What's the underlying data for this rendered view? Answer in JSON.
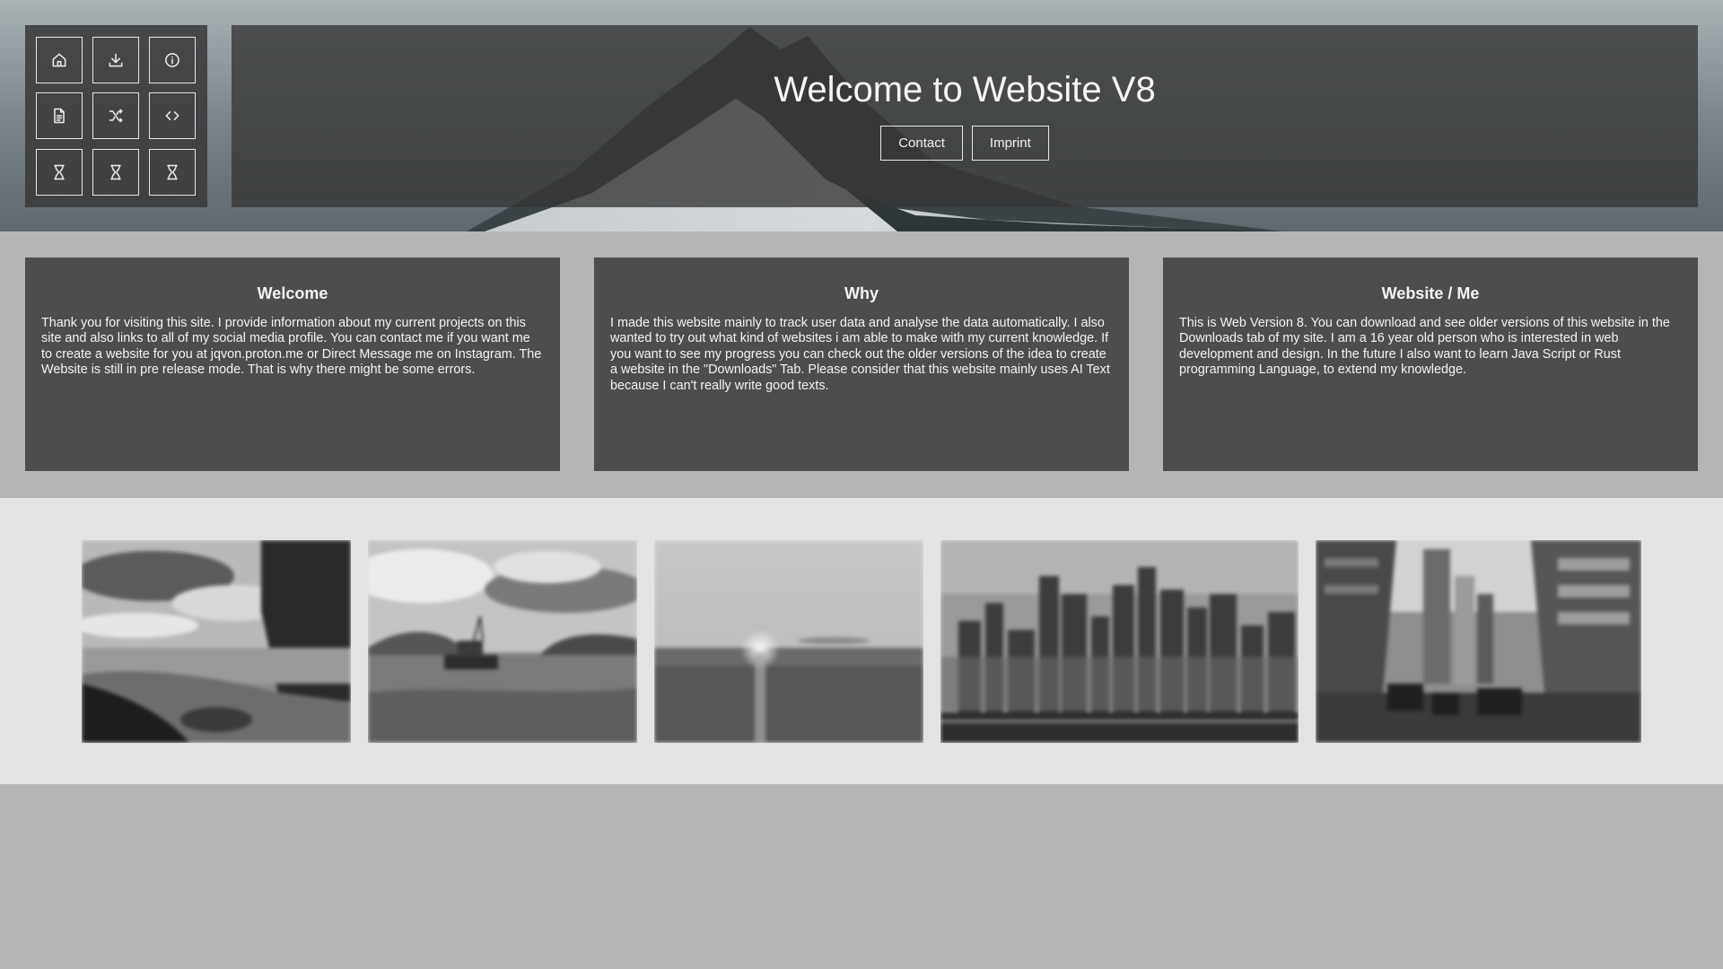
{
  "header": {
    "title": "Welcome to Website V8",
    "contact_label": "Contact",
    "imprint_label": "Imprint"
  },
  "nav": {
    "buttons": [
      {
        "icon": "home-icon"
      },
      {
        "icon": "download-icon"
      },
      {
        "icon": "info-icon"
      },
      {
        "icon": "document-icon"
      },
      {
        "icon": "shuffle-icon"
      },
      {
        "icon": "code-icon"
      },
      {
        "icon": "hourglass-icon"
      },
      {
        "icon": "hourglass-icon"
      },
      {
        "icon": "hourglass-icon"
      }
    ]
  },
  "cards": [
    {
      "title": "Welcome",
      "text": "Thank you for visiting this site. I provide information about my current projects on this site and also links to all of my social media profile. You can contact me if you want me to create a website for you at jqvon.proton.me or Direct Message me on Instagram. The Website is still in pre release mode. That is why there might be some errors."
    },
    {
      "title": "Why",
      "text": "I made this website mainly to track user data and analyse the data automatically. I also wanted to try out what kind of websites i am able to make with my current knowledge. If you want to see my progress you can check out the older versions of the idea to create a website in the \"Downloads\" Tab. Please consider that this website mainly uses AI Text because I can't really write good texts."
    },
    {
      "title": "Website / Me",
      "text": "This is Web Version 8. You can download and see older versions of this website in the Downloads tab of my site. I am a 16 year old person who is interested in web development and design. In the future I also want to learn Java Script or Rust programming Language, to extend my knowledge."
    }
  ],
  "colors": {
    "card_bg": "#4d4d4d",
    "page_bg": "#b5b5b5",
    "gallery_bg": "#e3e3e3"
  }
}
